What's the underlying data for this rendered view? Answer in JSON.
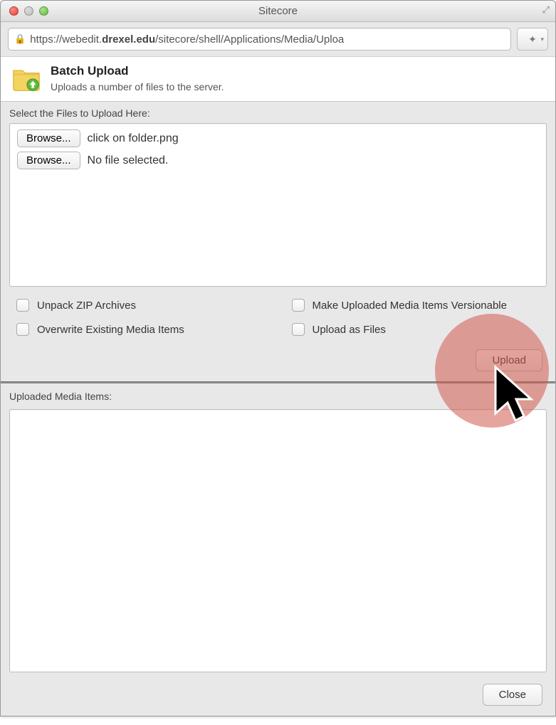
{
  "window": {
    "title": "Sitecore"
  },
  "addressbar": {
    "scheme": "https://",
    "domain_prefix": "webedit.",
    "domain_bold": "drexel.edu",
    "path": "/sitecore/shell/Applications/Media/Uploa"
  },
  "header": {
    "title": "Batch Upload",
    "subtitle": "Uploads a number of files to the server."
  },
  "select_label": "Select the Files to Upload Here:",
  "file_rows": [
    {
      "button": "Browse...",
      "text": "click on folder.png"
    },
    {
      "button": "Browse...",
      "text": "No file selected."
    }
  ],
  "checkboxes": {
    "unpack": "Unpack ZIP Archives",
    "versionable": "Make Uploaded Media Items Versionable",
    "overwrite": "Overwrite Existing Media Items",
    "as_files": "Upload as Files"
  },
  "buttons": {
    "upload": "Upload",
    "close": "Close"
  },
  "uploaded_label": "Uploaded Media Items:"
}
